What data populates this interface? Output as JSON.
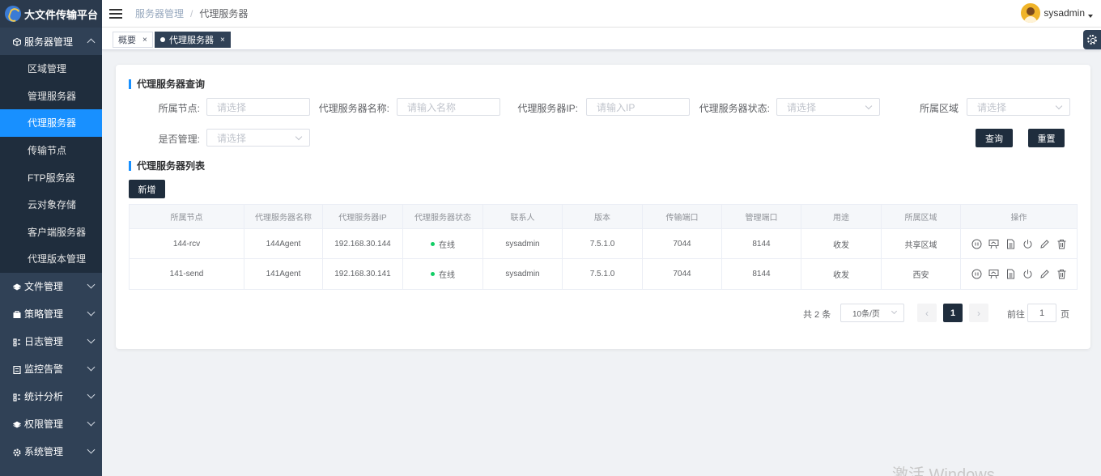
{
  "app": {
    "title": "大文件传输平台"
  },
  "header": {
    "breadcrumb": [
      "服务器管理",
      "代理服务器"
    ],
    "username": "sysadmin"
  },
  "sidebar": {
    "groups": [
      {
        "label": "服务器管理",
        "icon": "box-icon",
        "expanded": true,
        "items": [
          {
            "label": "区域管理"
          },
          {
            "label": "管理服务器"
          },
          {
            "label": "代理服务器",
            "active": true
          },
          {
            "label": "传输节点"
          },
          {
            "label": "FTP服务器"
          },
          {
            "label": "云对象存储"
          },
          {
            "label": "客户端服务器"
          },
          {
            "label": "代理版本管理"
          }
        ]
      },
      {
        "label": "文件管理",
        "icon": "layers-icon"
      },
      {
        "label": "策略管理",
        "icon": "policy-icon"
      },
      {
        "label": "日志管理",
        "icon": "log-icon"
      },
      {
        "label": "监控告警",
        "icon": "monitor-icon"
      },
      {
        "label": "统计分析",
        "icon": "stats-icon"
      },
      {
        "label": "权限管理",
        "icon": "permission-icon"
      },
      {
        "label": "系统管理",
        "icon": "system-icon"
      }
    ]
  },
  "tabs": [
    {
      "label": "概要",
      "close": "×"
    },
    {
      "label": "代理服务器",
      "close": "×",
      "active": true
    }
  ],
  "query": {
    "title": "代理服务器查询",
    "fields": {
      "node": {
        "label": "所属节点:",
        "placeholder": "请选择"
      },
      "name": {
        "label": "代理服务器名称:",
        "placeholder": "请输入名称"
      },
      "ip": {
        "label": "代理服务器IP:",
        "placeholder": "请输入IP"
      },
      "status": {
        "label": "代理服务器状态:",
        "placeholder": "请选择"
      },
      "region": {
        "label": "所属区域",
        "placeholder": "请选择"
      },
      "managed": {
        "label": "是否管理:",
        "placeholder": "请选择"
      }
    },
    "search_label": "查询",
    "reset_label": "重置"
  },
  "list": {
    "title": "代理服务器列表",
    "add_label": "新增",
    "columns": [
      "所属节点",
      "代理服务器名称",
      "代理服务器IP",
      "代理服务器状态",
      "联系人",
      "版本",
      "传输端口",
      "管理端口",
      "用途",
      "所属区域",
      "操作"
    ],
    "rows": [
      {
        "node": "144-rcv",
        "name": "144Agent",
        "ip": "192.168.30.144",
        "status": "在线",
        "contact": "sysadmin",
        "version": "7.5.1.0",
        "transfer_port": "7044",
        "manage_port": "8144",
        "usage": "收发",
        "region": "共享区域"
      },
      {
        "node": "141-send",
        "name": "141Agent",
        "ip": "192.168.30.141",
        "status": "在线",
        "contact": "sysadmin",
        "version": "7.5.1.0",
        "transfer_port": "7044",
        "manage_port": "8144",
        "usage": "收发",
        "region": "西安"
      }
    ],
    "status_color": "#13ce66"
  },
  "pagination": {
    "total": "共 2 条",
    "page_size": "10条/页",
    "prev": "‹",
    "next": "›",
    "current": "1",
    "goto_prefix": "前往",
    "goto_value": "1",
    "goto_suffix": "页"
  },
  "watermark": "激活 Windows"
}
